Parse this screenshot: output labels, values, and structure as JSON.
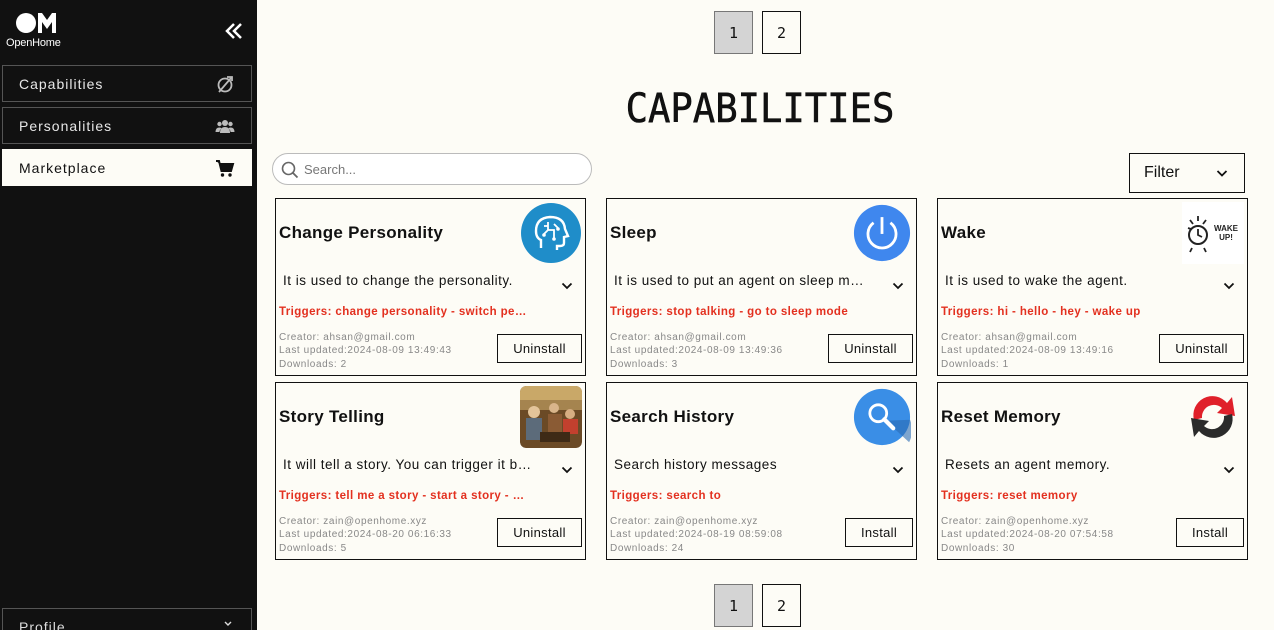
{
  "brand": {
    "name": "OpenHome"
  },
  "sidebar": {
    "items": [
      {
        "label": "Capabilities",
        "icon": "capabilities-icon"
      },
      {
        "label": "Personalities",
        "icon": "users-icon"
      },
      {
        "label": "Marketplace",
        "icon": "cart-icon",
        "active": true
      }
    ],
    "profile_label": "Profile"
  },
  "pagination": {
    "pages": [
      "1",
      "2"
    ],
    "current": "1"
  },
  "page_title": "CAPABILITIES",
  "search": {
    "placeholder": "Search...",
    "value": ""
  },
  "filter": {
    "label": "Filter"
  },
  "colors": {
    "sidebar_bg": "#111111",
    "page_bg": "#fdfcf6",
    "trigger_red": "#e3301f"
  },
  "cards": [
    {
      "title": "Change Personality",
      "description": "It is used to change the personality.",
      "triggers": "Triggers: change personality  - switch personality",
      "creator": "Creator: ahsan@gmail.com",
      "updated": "Last updated:2024-08-09 13:49:43",
      "downloads": "Downloads: 2",
      "button": "Uninstall",
      "icon": "ai-head-icon"
    },
    {
      "title": "Sleep",
      "description": "It is used to put an agent on sleep mode.",
      "triggers": "Triggers: stop talking  - go to sleep mode",
      "creator": "Creator: ahsan@gmail.com",
      "updated": "Last updated:2024-08-09 13:49:36",
      "downloads": "Downloads: 3",
      "button": "Uninstall",
      "icon": "power-icon"
    },
    {
      "title": "Wake",
      "description": "It is used to wake the agent.",
      "triggers": "Triggers: hi  - hello  - hey  - wake up",
      "creator": "Creator: ahsan@gmail.com",
      "updated": "Last updated:2024-08-09 13:49:16",
      "downloads": "Downloads: 1",
      "button": "Uninstall",
      "icon": "wake-up-icon",
      "icon_text": "WAKE UP!"
    },
    {
      "title": "Story Telling",
      "description": "It will tell a story. You can trigger it by saying tell me a story.",
      "triggers": "Triggers: tell me a story  - start a story  - story time",
      "creator": "Creator: zain@openhome.xyz",
      "updated": "Last updated:2024-08-20 06:16:33",
      "downloads": "Downloads: 5",
      "button": "Uninstall",
      "icon": "storytelling-image"
    },
    {
      "title": "Search History",
      "description": "Search history messages",
      "triggers": "Triggers: search to",
      "creator": "Creator: zain@openhome.xyz",
      "updated": "Last updated:2024-08-19 08:59:08",
      "downloads": "Downloads: 24",
      "button": "Install",
      "icon": "search-icon"
    },
    {
      "title": "Reset Memory",
      "description": "Resets an agent memory.",
      "triggers": "Triggers: reset memory",
      "creator": "Creator: zain@openhome.xyz",
      "updated": "Last updated:2024-08-20 07:54:58",
      "downloads": "Downloads: 30",
      "button": "Install",
      "icon": "reset-icon"
    }
  ]
}
